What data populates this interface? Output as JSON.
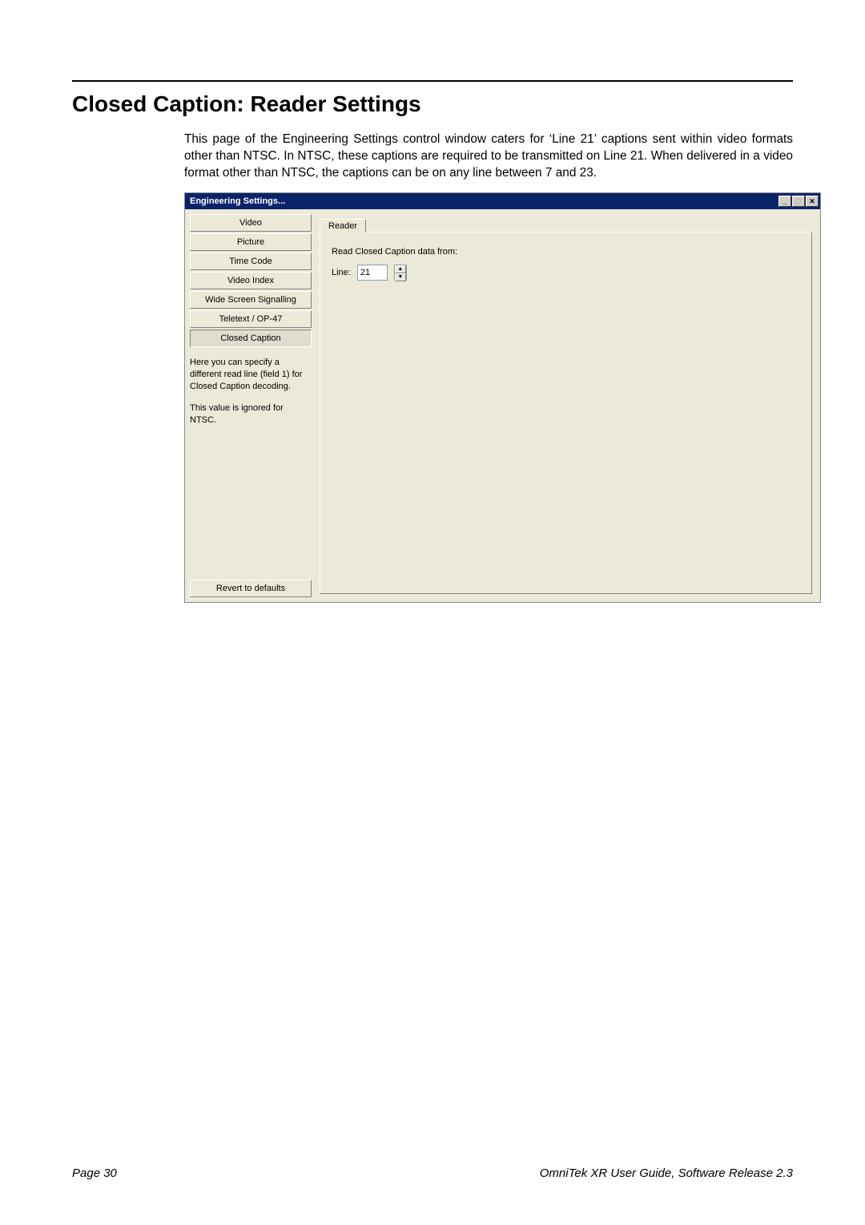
{
  "heading": "Closed Caption: Reader Settings",
  "paragraph": "This page of the Engineering Settings control window caters for ‘Line 21’ captions sent within video formats other than NTSC. In NTSC, these captions are required to be transmitted on Line 21. When delivered in a video format other than NTSC, the captions can be on any line between 7 and 23.",
  "dialog": {
    "title": "Engineering Settings...",
    "window_buttons": {
      "min": "_",
      "max": "□",
      "close": "✕"
    },
    "sidebar": {
      "items": [
        {
          "label": "Video"
        },
        {
          "label": "Picture"
        },
        {
          "label": "Time Code"
        },
        {
          "label": "Video Index"
        },
        {
          "label": "Wide Screen Signalling"
        },
        {
          "label": "Teletext / OP-47"
        },
        {
          "label": "Closed Caption"
        }
      ],
      "hint1": "Here you can specify a different read line (field 1) for Closed Caption decoding.",
      "hint2": "This value is ignored for NTSC.",
      "revert": "Revert to defaults"
    },
    "tab": {
      "label": "Reader"
    },
    "form": {
      "read_label": "Read Closed Caption data from:",
      "line_label": "Line:",
      "line_value": "21"
    }
  },
  "footer": {
    "left": "Page 30",
    "right": "OmniTek XR User Guide, Software Release 2.3"
  }
}
